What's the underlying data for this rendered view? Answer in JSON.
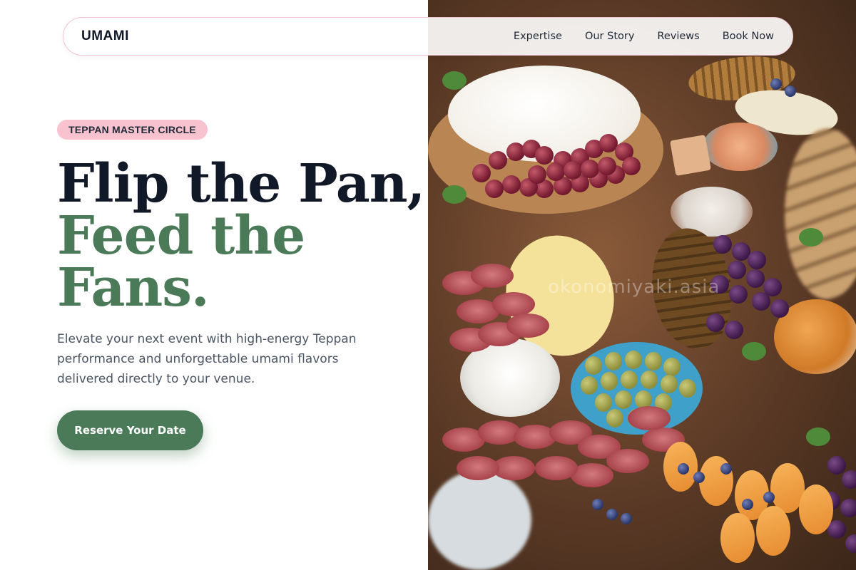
{
  "nav": {
    "logo": "UMAMI",
    "links": [
      "Expertise",
      "Our Story",
      "Reviews",
      "Book Now"
    ]
  },
  "hero": {
    "badge": "TEPPAN MASTER CIRCLE",
    "headline_line1": "Flip the Pan,",
    "headline_line2": "Feed the",
    "headline_line3": "Fans.",
    "description": "Elevate your next event with high-energy Teppan performance and unforgettable umami flavors delivered directly to your venue.",
    "cta_label": "Reserve Your Date"
  },
  "image": {
    "watermark": "okonomiyaki.asia",
    "subject": "charcuterie-board-photo"
  },
  "colors": {
    "accent_green": "#4a7a57",
    "badge_pink": "#f8c3cf",
    "heading_dark": "#111827",
    "body_gray": "#4b5563"
  }
}
